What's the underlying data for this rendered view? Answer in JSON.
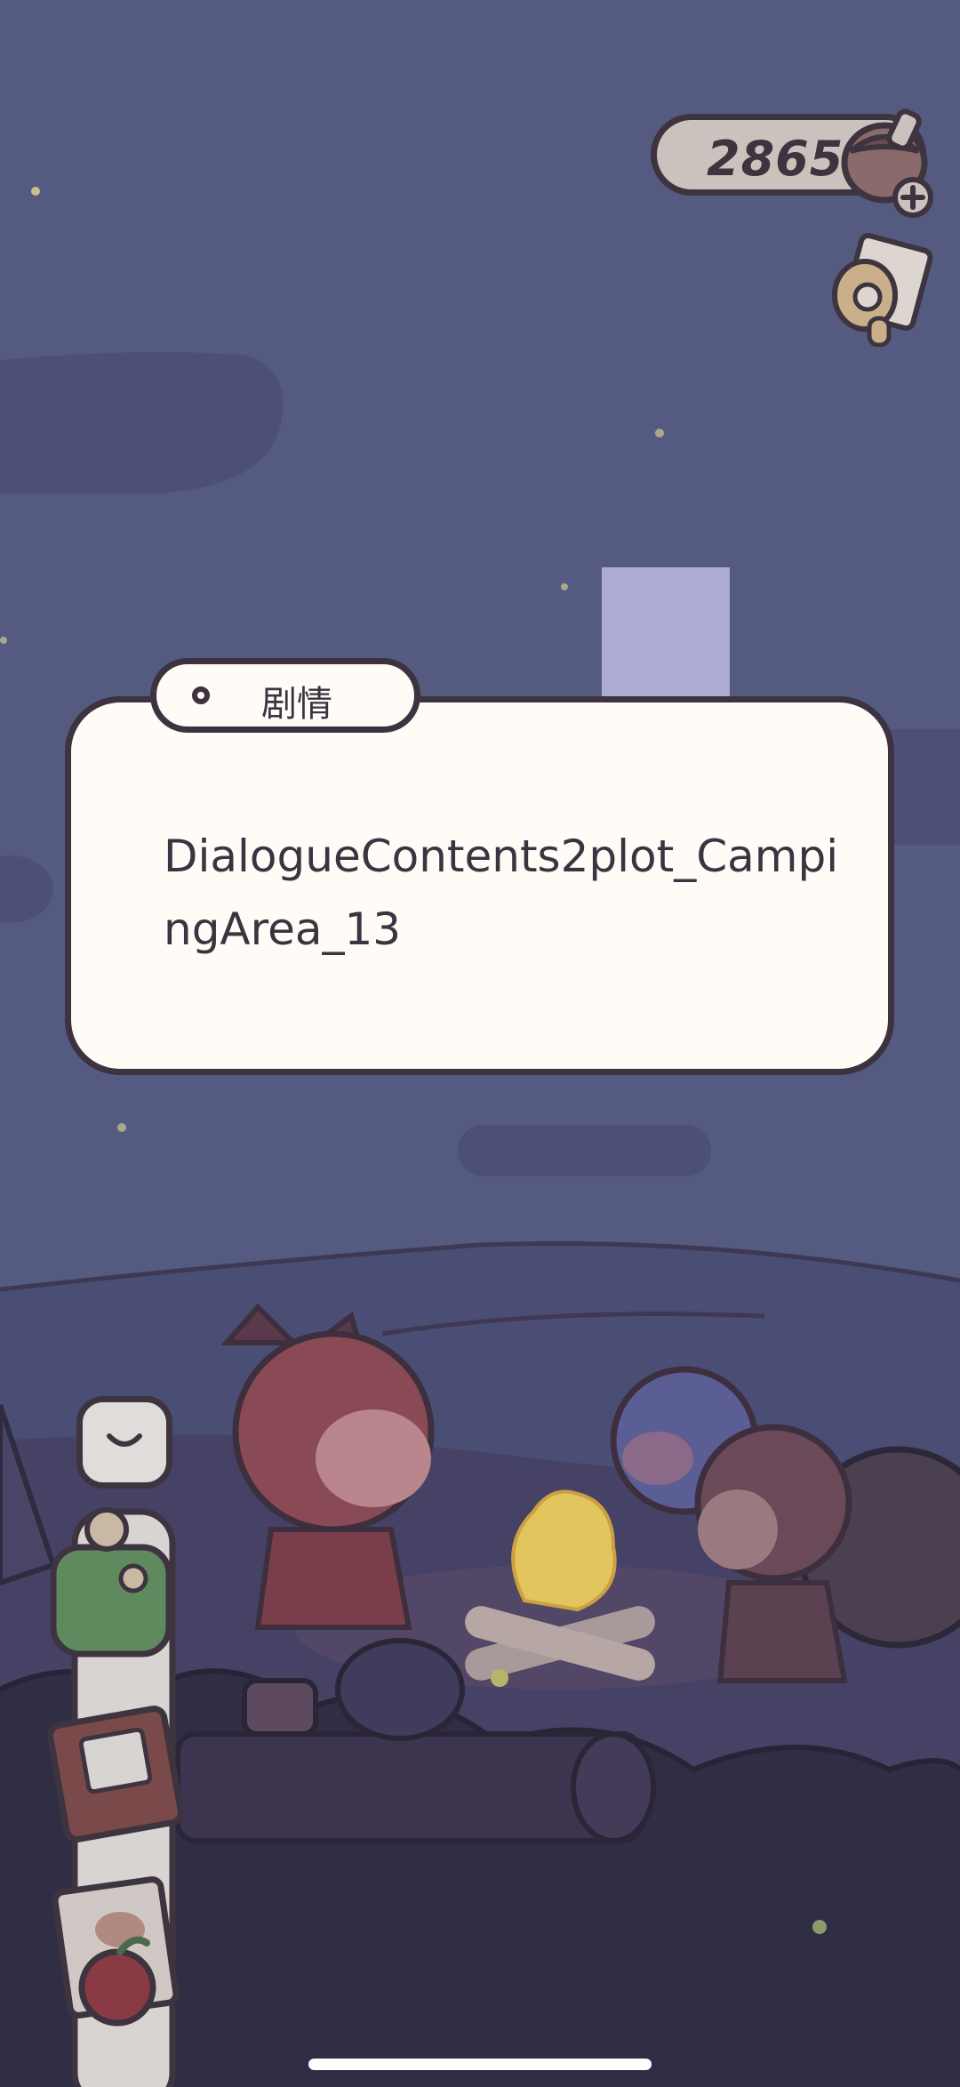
{
  "hud": {
    "currency_value": "2865",
    "currency_icon": "acorn-icon",
    "add_icon": "plus-icon",
    "scroll_icon": "scroll-icon"
  },
  "dialog": {
    "tab_label": "剧情",
    "text": "DialogueContents2plot_CampingArea_13"
  },
  "side_menu": {
    "collapse_icon": "chevron-down-icon",
    "items": [
      "backpack-icon",
      "book-icon",
      "map-icon",
      "apple-icon"
    ]
  },
  "colors": {
    "sky": "#555a80",
    "dialog_bg": "#fffbf6",
    "outline": "#3d3340",
    "highlight": "#aeacd4"
  }
}
